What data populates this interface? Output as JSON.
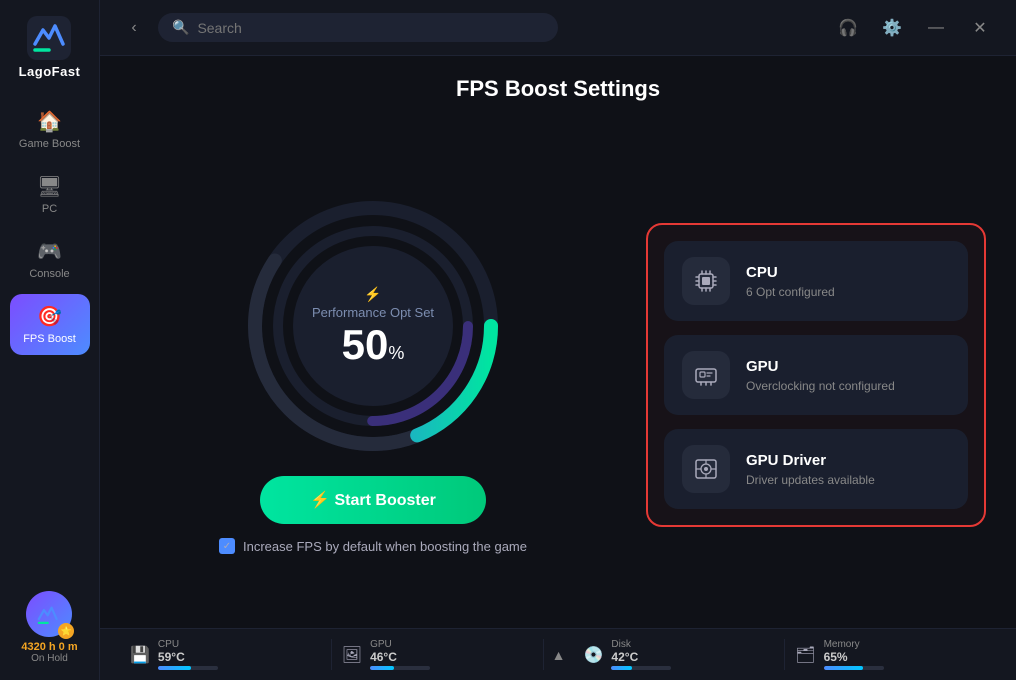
{
  "sidebar": {
    "logo": "LagoFast",
    "nav_items": [
      {
        "id": "game-boost",
        "label": "Game Boost",
        "icon": "🏠",
        "active": false
      },
      {
        "id": "pc",
        "label": "PC",
        "icon": "🖥",
        "active": false
      },
      {
        "id": "console",
        "label": "Console",
        "icon": "🎮",
        "active": false
      },
      {
        "id": "fps-boost",
        "label": "FPS Boost",
        "icon": "🎯",
        "active": true
      }
    ],
    "user": {
      "time": "4320 h 0 m",
      "status": "On Hold"
    }
  },
  "topbar": {
    "back_label": "‹",
    "search_placeholder": "Search",
    "actions": [
      "headset",
      "settings",
      "minimize",
      "close"
    ]
  },
  "page": {
    "title": "FPS Boost Settings",
    "gauge": {
      "label": "Performance Opt Set",
      "bolt": "⚡",
      "value": "50",
      "unit": "%"
    },
    "start_button": "⚡  Start Booster",
    "checkbox_label": "Increase FPS by default when boosting the game"
  },
  "cards": [
    {
      "id": "cpu",
      "title": "CPU",
      "subtitle": "6 Opt configured",
      "icon": "💾"
    },
    {
      "id": "gpu",
      "title": "GPU",
      "subtitle": "Overclocking not configured",
      "icon": "🖼"
    },
    {
      "id": "gpu-driver",
      "title": "GPU Driver",
      "subtitle": "Driver updates available",
      "icon": "💿"
    }
  ],
  "bottom_bar": [
    {
      "id": "cpu-status",
      "name": "CPU",
      "value": "59°C",
      "bar_pct": 55
    },
    {
      "id": "gpu-status",
      "name": "GPU",
      "value": "46°C",
      "bar_pct": 40
    },
    {
      "id": "disk-status",
      "name": "Disk",
      "value": "42°C",
      "bar_pct": 35
    },
    {
      "id": "memory-status",
      "name": "Memory",
      "value": "65%",
      "bar_pct": 65
    }
  ]
}
